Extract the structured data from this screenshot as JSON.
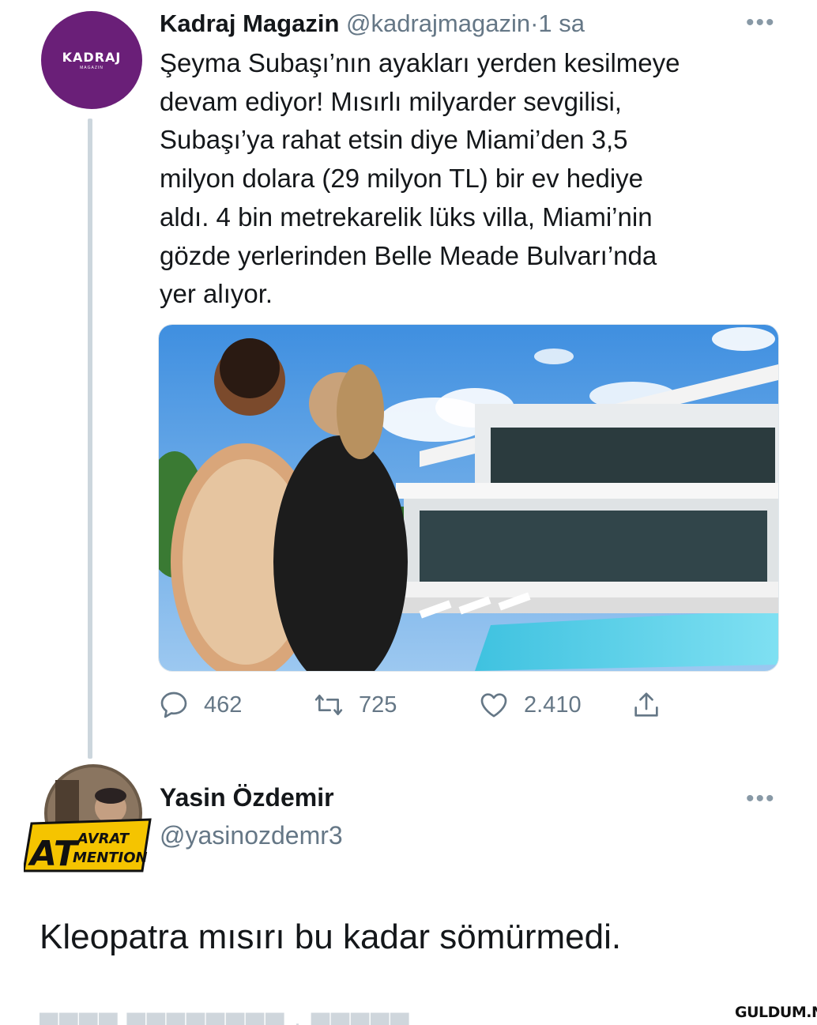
{
  "tweet1": {
    "avatar": {
      "logo_text": "KADRAJ",
      "logo_subtext": "MAGAZIN",
      "color": "#6a1f78"
    },
    "author_name": "Kadraj Magazin",
    "handle": "@kadrajmagazin",
    "separator": "·",
    "time": "1 sa",
    "more_icon": "more-horizontal-icon",
    "text": "Şeyma Subaşı’nın ayakları yerden kesilmeye\ndevam ediyor! Mısırlı milyarder sevgilisi,\nSubaşı’ya rahat etsin diye Miami’den 3,5\nmilyon dolara (29 milyon TL) bir ev hediye\naldı. 4 bin metrekarelik lüks villa, Miami’nin\ngözde yerlerinden Belle Meade Bulvarı’nda\nyer alıyor.",
    "media": {
      "description_icon": "photo-couple-villa"
    },
    "actions": {
      "reply": {
        "icon": "reply-bubble-icon",
        "count": "462"
      },
      "retweet": {
        "icon": "retweet-icon",
        "count": "725"
      },
      "like": {
        "icon": "heart-icon",
        "count": "2.410"
      },
      "share": {
        "icon": "share-icon"
      }
    }
  },
  "tweet2": {
    "avatar": {
      "badge_line1": "AT",
      "badge_line2": "AVRAT",
      "badge_line3": "MENTION",
      "badge_color": "#f5c400"
    },
    "author_name": "Yasin Özdemir",
    "handle": "@yasinozdemr3",
    "more_icon": "more-horizontal-icon",
    "text": "Kleopatra mısırı bu kadar sömürmedi."
  },
  "watermark": "GULDUM.NET",
  "colors": {
    "text": "#14171a",
    "secondary": "#657786",
    "thread_line": "#ccd6dd"
  }
}
